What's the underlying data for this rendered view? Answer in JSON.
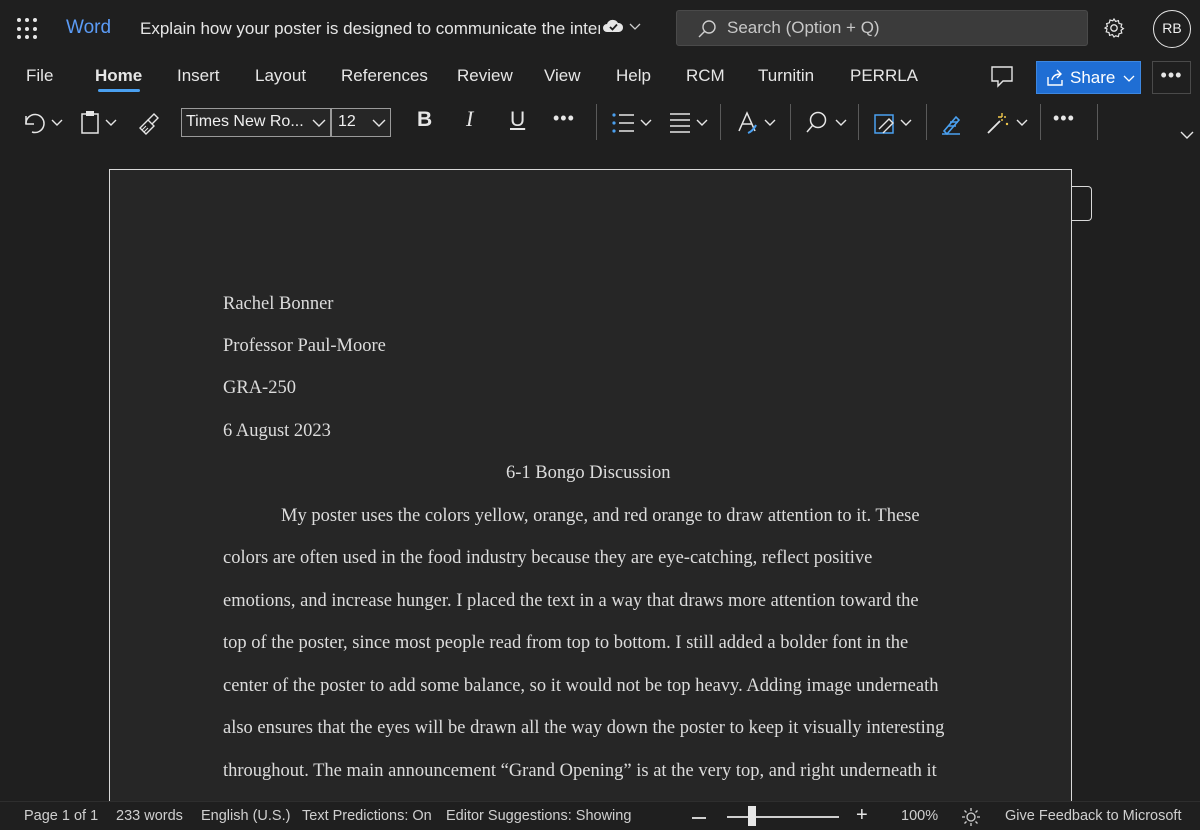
{
  "titlebar": {
    "app_name": "Word",
    "doc_title": "Explain how your poster is designed to communicate the inten",
    "search_placeholder": "Search (Option + Q)",
    "avatar_initials": "RB"
  },
  "tabs": [
    "File",
    "Home",
    "Insert",
    "Layout",
    "References",
    "Review",
    "View",
    "Help",
    "RCM",
    "Turnitin",
    "PERRLA"
  ],
  "active_tab": "Home",
  "share": {
    "label": "Share"
  },
  "ribbon": {
    "font_name": "Times New Ro...",
    "font_size": "12",
    "bold": "B",
    "italic": "I",
    "underline": "U",
    "more": "•••",
    "more_end": "•••"
  },
  "document": {
    "header_lines": [
      "Rachel Bonner",
      "Professor Paul-Moore",
      "GRA-250",
      "6 August 2023"
    ],
    "title": "6-1 Bongo Discussion",
    "body_lines": [
      "My poster uses the colors yellow, orange, and red orange to draw attention to it. These",
      "colors are often used in the food industry because they are eye-catching, reflect positive",
      "emotions, and increase hunger. I placed the text in a way that draws more attention toward the",
      "top of the poster, since most people read from top to bottom. I still added a bolder font in the",
      "center of the poster to add some balance, so it would not be top heavy. Adding image underneath",
      "also ensures that the eyes will be drawn all the way down the poster to keep it visually interesting",
      "throughout. The main announcement “Grand Opening” is at the very top, and right underneath it"
    ]
  },
  "statusbar": {
    "page": "Page 1 of 1",
    "words": "233 words",
    "language": "English (U.S.)",
    "predictions": "Text Predictions: On",
    "editor": "Editor Suggestions: Showing",
    "zoom": "100%",
    "zoom_level_percent": 100,
    "feedback": "Give Feedback to Microsoft"
  },
  "colors": {
    "accent": "#5b9bf5",
    "share_button": "#1f6ed4",
    "tab_underline": "#4aa0f0",
    "background": "#1f1f1f",
    "page": "#262626"
  },
  "icons": [
    "app-launcher-icon",
    "cloud-sync-icon",
    "search-icon",
    "settings-icon",
    "comment-icon",
    "share-icon",
    "undo-icon",
    "clipboard-icon",
    "format-painter-icon",
    "bullets-icon",
    "align-icon",
    "styles-icon",
    "find-icon",
    "sensitivity-icon",
    "dictate-icon",
    "designer-icon",
    "brightness-icon"
  ]
}
